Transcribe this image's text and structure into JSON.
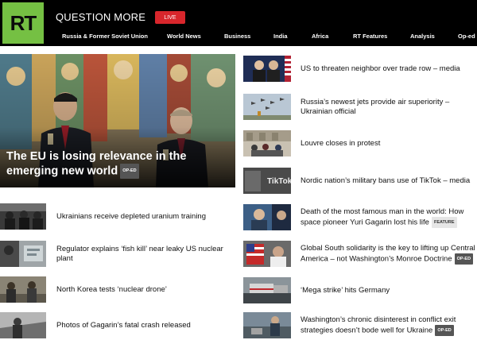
{
  "header": {
    "logo_text": "RT",
    "tagline": "QUESTION MORE",
    "live_label": "LIVE",
    "nav": [
      "Russia & Former Soviet Union",
      "World News",
      "Business",
      "India",
      "Africa",
      "RT Features",
      "Analysis",
      "Op-ed"
    ]
  },
  "hero": {
    "title": "The EU is losing relevance in the emerging new world",
    "badge": "OP-ED"
  },
  "left_stories": [
    {
      "title": "Ukrainians receive depleted uranium training"
    },
    {
      "title": "Regulator explains ‘fish kill’ near leaky US nuclear plant"
    },
    {
      "title": "North Korea tests ‘nuclear drone’"
    },
    {
      "title": "Photos of Gagarin’s fatal crash released"
    }
  ],
  "right_stories": [
    {
      "title": "US to threaten neighbor over trade row – media",
      "badge": ""
    },
    {
      "title": "Russia’s newest jets provide air superiority – Ukrainian official",
      "badge": ""
    },
    {
      "title": "Louvre closes in protest",
      "badge": ""
    },
    {
      "title": "Nordic nation’s military bans use of TikTok – media",
      "badge": ""
    },
    {
      "title": "Death of the most famous man in the world: How space pioneer Yuri Gagarin lost his life",
      "badge": "FEATURE"
    },
    {
      "title": "Global South solidarity is the key to lifting up Central America – not Washington’s Monroe Doctrine",
      "badge": "OP-ED"
    },
    {
      "title": "‘Mega strike’ hits Germany",
      "badge": ""
    },
    {
      "title": "Washington’s chronic disinterest in conflict exit strategies doesn’t bode well for Ukraine",
      "badge": "OP-ED"
    }
  ],
  "thumb_text": {
    "tiktok": "TikTok"
  },
  "colors": {
    "brand_green": "#75c043",
    "live_red": "#d8262c",
    "header_bg": "#000000"
  }
}
